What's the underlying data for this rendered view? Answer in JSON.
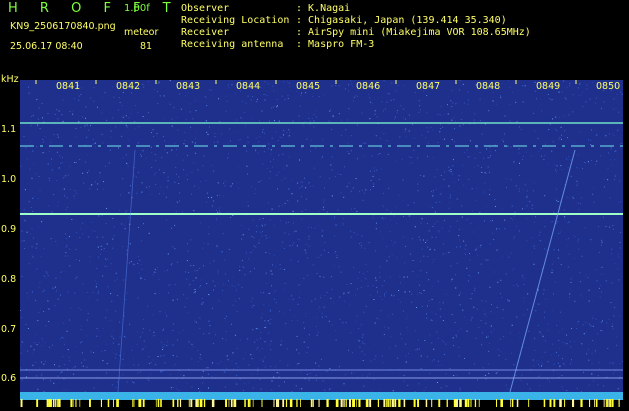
{
  "app": {
    "logo": "H R O F F T",
    "version": "1.00f"
  },
  "file": {
    "name": "KN9_2506170840.png",
    "datetime": "25.06.17 08:40"
  },
  "meteor": {
    "label": "meteor",
    "count": "81"
  },
  "info": [
    {
      "key": "Observer",
      "value": ": K.Nagai"
    },
    {
      "key": "Receiving Location",
      "value": ": Chigasaki, Japan (139.414 35.340)"
    },
    {
      "key": "Receiver",
      "value": ": AirSpy mini (Miakejima VOR 108.65MHz)"
    },
    {
      "key": "Receiving antenna",
      "value": ": Maspro FM-3"
    }
  ],
  "axis": {
    "y_unit": "kHz",
    "y_ticks": [
      "1.1",
      "1.0",
      "0.9",
      "0.8",
      "0.7",
      "0.6"
    ],
    "x_ticks": [
      "0841",
      "0842",
      "0843",
      "0844",
      "0845",
      "0846",
      "0847",
      "0848",
      "0849",
      "0850"
    ]
  },
  "colors": {
    "background": "#1f2f8c",
    "label": "#ffff66",
    "trace": "#9fffc8"
  }
}
